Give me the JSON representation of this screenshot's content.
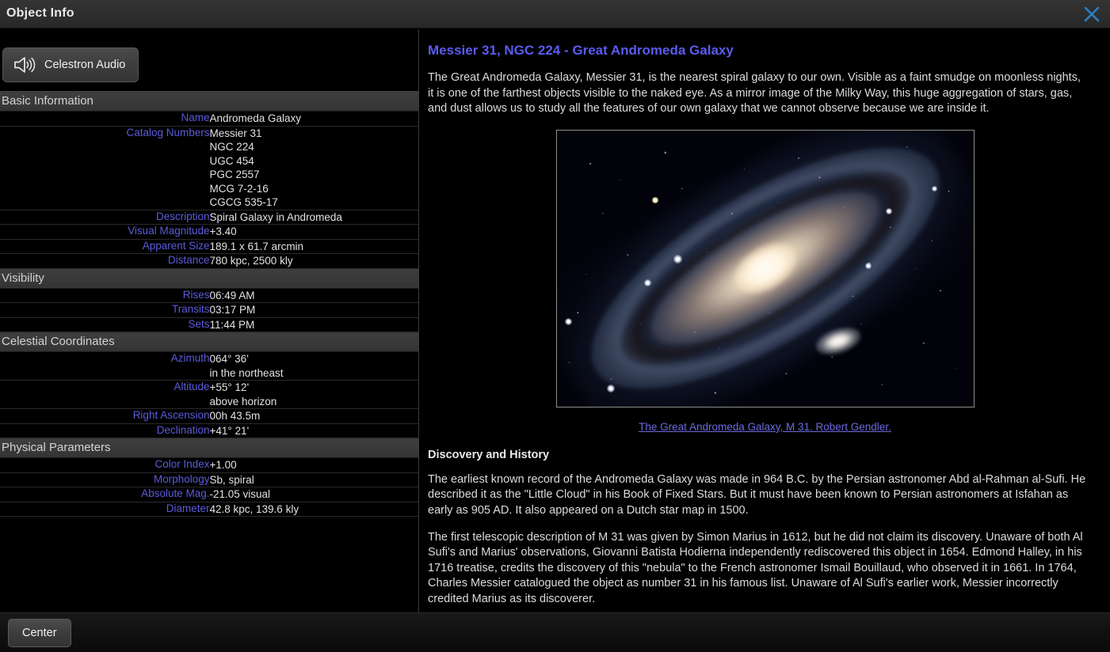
{
  "window": {
    "title": "Object Info",
    "close_icon": "close-x-icon"
  },
  "left_panel": {
    "audio_button": {
      "label": "Celestron Audio",
      "icon": "speaker-audio-icon"
    },
    "sections": [
      {
        "heading": "Basic Information",
        "rows": [
          {
            "label": "Name",
            "value": "Andromeda Galaxy"
          },
          {
            "label": "Catalog Numbers",
            "value": "Messier 31\nNGC 224\nUGC 454\nPGC 2557\nMCG 7-2-16\nCGCG 535-17"
          },
          {
            "label": "Description",
            "value": "Spiral Galaxy in Andromeda"
          },
          {
            "label": "Visual Magnitude",
            "value": "+3.40"
          },
          {
            "label": "Apparent Size",
            "value": "189.1 x 61.7 arcmin"
          },
          {
            "label": "Distance",
            "value": "780 kpc, 2500 kly"
          }
        ]
      },
      {
        "heading": "Visibility",
        "rows": [
          {
            "label": "Rises",
            "value": "06:49 AM"
          },
          {
            "label": "Transits",
            "value": "03:17 PM"
          },
          {
            "label": "Sets",
            "value": "11:44 PM"
          }
        ]
      },
      {
        "heading": "Celestial Coordinates",
        "rows": [
          {
            "label": "Azimuth",
            "value": "064° 36'\nin the northeast"
          },
          {
            "label": "Altitude",
            "value": "+55° 12'\nabove horizon"
          },
          {
            "label": "Right Ascension",
            "value": "00h 43.5m"
          },
          {
            "label": "Declination",
            "value": "+41° 21'"
          }
        ]
      },
      {
        "heading": "Physical Parameters",
        "rows": [
          {
            "label": "Color Index",
            "value": "+1.00"
          },
          {
            "label": "Morphology",
            "value": "Sb, spiral"
          },
          {
            "label": "Absolute Mag.",
            "value": "-21.05 visual"
          },
          {
            "label": "Diameter",
            "value": "42.8 kpc, 139.6 kly"
          }
        ]
      }
    ]
  },
  "right_panel": {
    "title": "Messier 31, NGC 224 - Great Andromeda Galaxy",
    "intro": "The Great Andromeda Galaxy, Messier 31, is the nearest spiral galaxy to our own. Visible as a faint smudge on moonless nights, it is one of the farthest objects visible to the naked eye. As a mirror image of the Milky Way, this huge aggregation of stars, gas, and dust allows us to study all the features of our own galaxy that we cannot observe because we are inside it.",
    "figure": {
      "alt": "andromeda-galaxy-photo",
      "caption": "The Great Andromeda Galaxy, M 31. Robert Gendler."
    },
    "subheading": "Discovery and History",
    "history_1": "The earliest known record of the Andromeda Galaxy was made in 964 B.C. by the Persian astronomer Abd al-Rahman al-Sufi. He described it as the \"Little Cloud\" in his Book of Fixed Stars. But it must have been known to Persian astronomers at Isfahan as early as 905 AD. It also appeared on a Dutch star map in 1500.",
    "history_2": "The first telescopic description of M 31 was given by Simon Marius in 1612, but he did not claim its discovery. Unaware of both Al Sufi's and Marius' observations, Giovanni Batista Hodierna independently rediscovered this object in 1654. Edmond Halley, in his 1716 treatise, credits the discovery of this \"nebula\" to the French astronomer Ismail Bouillaud, who observed it in 1661. In 1764, Charles Messier catalogued the object as number 31 in his famous list. Unaware of Al Sufi's earlier work, Messier incorrectly credited Marius as its discoverer."
  },
  "bottom_bar": {
    "center_button": "Center"
  },
  "colors": {
    "label_blue": "#5b5bdc",
    "title_blue": "#5b5bf0",
    "link_blue": "#6a6ae0",
    "close_blue": "#2b7fc4",
    "section_band": "#3a3a3a",
    "titlebar": "#2f2f2f"
  }
}
